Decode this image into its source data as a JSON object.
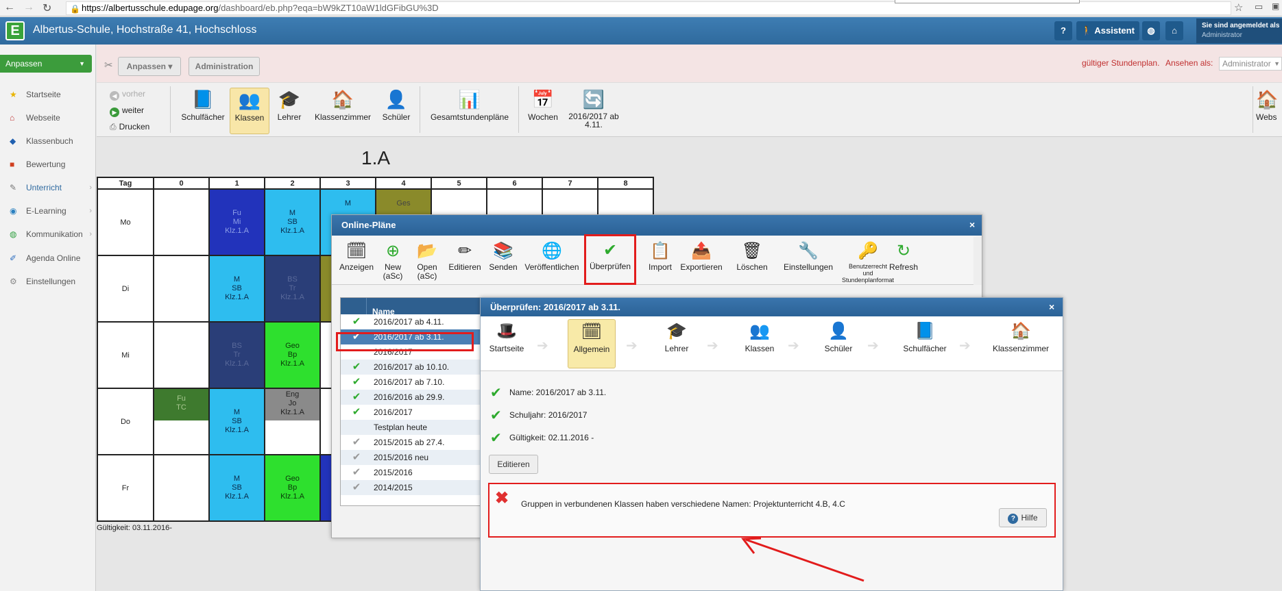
{
  "browser": {
    "url_host": "https://albertusschule.edupage.org",
    "url_path": "/dashboard/eb.php?eqa=bW9kZT10aW1ldGFibGU%3D",
    "back_icon": "back-arrow-icon",
    "forward_icon": "forward-arrow-icon",
    "reload_icon": "reload-icon",
    "star_icon": "star-icon"
  },
  "header": {
    "logo": "E",
    "school_name": "Albertus-Schule, Hochstraße 41, Hochschloss",
    "help_label": "?",
    "assistant_label": "Assistent",
    "logged_in_label": "Sie sind angemeldet als",
    "logged_in_user": "Administrator"
  },
  "sidebar": {
    "anpassen_label": "Anpassen",
    "items": [
      {
        "label": "Startseite",
        "icon": "star-icon",
        "color": "#e8b400"
      },
      {
        "label": "Webseite",
        "icon": "house-icon",
        "color": "#c03030"
      },
      {
        "label": "Klassenbuch",
        "icon": "book-icon",
        "color": "#2060b0"
      },
      {
        "label": "Bewertung",
        "icon": "grade-icon",
        "color": "#d04020"
      },
      {
        "label": "Unterricht",
        "icon": "lesson-icon",
        "color": "#777777"
      },
      {
        "label": "E-Learning",
        "icon": "elearning-icon",
        "color": "#2a80c0"
      },
      {
        "label": "Kommunikation",
        "icon": "globe-icon",
        "color": "#30a040"
      },
      {
        "label": "Agenda Online",
        "icon": "pen-icon",
        "color": "#3070c0"
      },
      {
        "label": "Einstellungen",
        "icon": "gear-icon",
        "color": "#888888"
      }
    ]
  },
  "topbar": {
    "anpassen_label": "Anpassen ▾",
    "administration_label": "Administration",
    "stundenplan_label": "gültiger Stundenplan.",
    "ansehen_label": "Ansehen als:",
    "ansehen_value": "Administrator"
  },
  "iconbar": {
    "vorher": "vorher",
    "weiter": "weiter",
    "drucken": "Drucken",
    "items": [
      "Schulfächer",
      "Klassen",
      "Lehrer",
      "Klassenzimmer",
      "Schüler",
      "Gesamtstundenpläne",
      "Wochen",
      "2016/2017 ab\n4.11."
    ],
    "right_label": "Webs"
  },
  "timetable": {
    "title": "1.A",
    "headers": [
      "Tag",
      "0",
      "1",
      "2",
      "3",
      "4",
      "5",
      "6",
      "7",
      "8"
    ],
    "days": [
      "Mo",
      "Di",
      "Mi",
      "Do",
      "Fr"
    ],
    "validity": "Gültigkeit: 03.11.2016-",
    "cells": {
      "mo1": "Fu\nMi\nKlz.1.A",
      "mo2": "M\nSB\nKlz.1.A",
      "mo3": "M",
      "mo4": "Ges",
      "di1": "M\nSB\nKlz.1.A",
      "di2": "BS\nTr\nKlz.1.A",
      "mi1": "BS\nTr\nKlz.1.A",
      "mi2": "Geo\nBp\nKlz.1.A",
      "do0": "Fu\nTC",
      "do1": "M\nSB\nKlz.1.A",
      "do2": "Eng\nJo\nKlz.1.A",
      "fr1": "M\nSB\nKlz.1.A",
      "fr2": "Geo\nBp\nKlz.1.A"
    }
  },
  "online_plaene": {
    "title": "Online-Pläne",
    "close": "×",
    "toolbar": [
      "Anzeigen",
      "New\n(aSc)",
      "Open\n(aSc)",
      "Editieren",
      "Senden",
      "Veröffentlichen",
      "Überprüfen",
      "Import",
      "Exportieren",
      "Löschen",
      "Einstellungen",
      "Benutzerrecht\nund\nStundenplanformat",
      "Refresh"
    ],
    "list_header": "Name",
    "rows": [
      {
        "name": "2016/2017 ab 4.11.",
        "check": "✔",
        "color": "#2eaa2e"
      },
      {
        "name": "2016/2017 ab 3.11.",
        "check": "✔",
        "color": "#ffffff"
      },
      {
        "name": "2016/2017",
        "check": "",
        "color": "#2eaa2e"
      },
      {
        "name": "2016/2017 ab 10.10.",
        "check": "✔",
        "color": "#2eaa2e"
      },
      {
        "name": "2016/2017 ab 7.10.",
        "check": "✔",
        "color": "#2eaa2e"
      },
      {
        "name": "2016/2016 ab 29.9.",
        "check": "✔",
        "color": "#2eaa2e"
      },
      {
        "name": "2016/2017",
        "check": "✔",
        "color": "#2eaa2e"
      },
      {
        "name": "Testplan heute",
        "check": "",
        "color": "#999999"
      },
      {
        "name": "2015/2015 ab 27.4.",
        "check": "✔",
        "color": "#999999"
      },
      {
        "name": "2015/2016 neu",
        "check": "✔",
        "color": "#999999"
      },
      {
        "name": "2015/2016",
        "check": "✔",
        "color": "#999999"
      },
      {
        "name": "2014/2015",
        "check": "✔",
        "color": "#999999"
      }
    ]
  },
  "ueberpruefen": {
    "title": "Überprüfen: 2016/2017 ab 3.11.",
    "close": "×",
    "steps": [
      "Startseite",
      "Allgemein",
      "Lehrer",
      "Klassen",
      "Schüler",
      "Schulfächer",
      "Klassenzimmer"
    ],
    "name_line": "Name: 2016/2017 ab 3.11.",
    "schuljahr_line": "Schuljahr: 2016/2017",
    "gueltigkeit_line": "Gültigkeit: 02.11.2016 -",
    "edit_label": "Editieren",
    "error_message": "Gruppen in verbundenen Klassen haben verschiedene Namen: Projektunterricht 4.B, 4.C",
    "hilfe_label": "Hilfe"
  },
  "colors": {
    "header_blue": "#2f6a9d",
    "highlight_red": "#e21c1c",
    "cell_dark_blue": "#2a3e78",
    "cell_blue": "#2ebdef",
    "cell_royal": "#2233bb",
    "cell_green": "#2ee02e",
    "cell_olive": "#8a8a2a",
    "cell_grey": "#8a8a8a",
    "cell_darkgreen": "#3e7a2e"
  }
}
